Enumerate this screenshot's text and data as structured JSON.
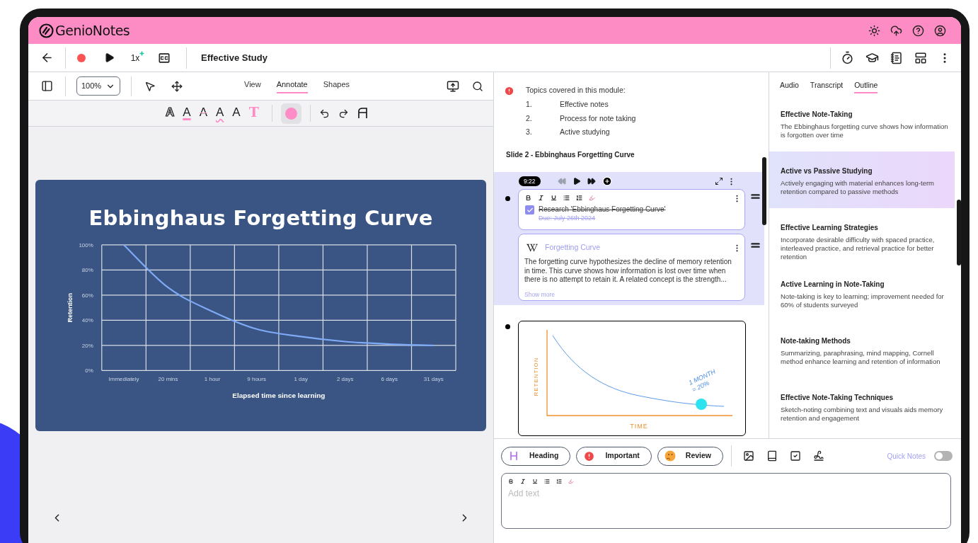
{
  "app": {
    "name": "GenioNotes"
  },
  "toolbar": {
    "speed": "1x",
    "title": "Effective Study"
  },
  "canvas_toolbar": {
    "zoom": "100%",
    "tabs": [
      {
        "label": "View",
        "selected": false
      },
      {
        "label": "Annotate",
        "selected": true
      },
      {
        "label": "Shapes",
        "selected": false
      }
    ]
  },
  "text_tools": [
    {
      "kind": "outline",
      "label": "A"
    },
    {
      "kind": "underline",
      "label": "A"
    },
    {
      "kind": "strike",
      "label": "A"
    },
    {
      "kind": "wavy",
      "label": "A"
    },
    {
      "kind": "plain",
      "label": "A"
    },
    {
      "kind": "type",
      "label": "T"
    }
  ],
  "slide": {
    "title": "Ebbinghaus Forgetting Curve",
    "chart_data": {
      "type": "line",
      "xlabel": "Elapsed time since learning",
      "ylabel": "Retention",
      "categories": [
        "Immediately",
        "20 mins",
        "1 hour",
        "9 hours",
        "1 day",
        "2 days",
        "6 days",
        "31 days"
      ],
      "series": [
        {
          "color": "#7eaaf6",
          "values": [
            100,
            66,
            47,
            33,
            27,
            23,
            21,
            20
          ]
        }
      ],
      "grid": true,
      "ylim": [
        0,
        100
      ],
      "yticks": [
        {
          "value": 0,
          "label": "0%"
        },
        {
          "value": 20,
          "label": "20%"
        },
        {
          "value": 40,
          "label": "40%"
        },
        {
          "value": 60,
          "label": "60%"
        },
        {
          "value": 80,
          "label": "80%"
        },
        {
          "value": 100,
          "label": "100%"
        }
      ]
    }
  },
  "notes": {
    "important": {
      "title": "Topics covered in this module:",
      "items": [
        {
          "number": "1.",
          "text": "Effective notes"
        },
        {
          "number": "2.",
          "text": "Process for note taking"
        },
        {
          "number": "3.",
          "text": "Active studying"
        }
      ]
    },
    "slide_heading": "Slide 2 - Ebbinghaus Forgetting Curve",
    "clip": {
      "time": "9:22",
      "rewind_disabled": true
    },
    "task": {
      "text": "Research 'Ebbinghaus Forgetting Curve'",
      "due": "Due: July 26th 2024",
      "checked": true
    },
    "wiki": {
      "title": "Forgetting Curve",
      "text": "The forgetting curve hypothesizes the decline of memory retention in time. This curve shows how information is lost over time when there is no attempt to retain it. A related concept is the strength...",
      "more": "Show more"
    },
    "sketch": {
      "ylabel": "RETENTION",
      "xlabel": "TIME",
      "note": [
        "1 MONTH",
        "= 20%"
      ]
    }
  },
  "outline": {
    "tabs": [
      {
        "label": "Audio",
        "selected": false
      },
      {
        "label": "Transcript",
        "selected": false
      },
      {
        "label": "Outline",
        "selected": true
      }
    ],
    "items": [
      {
        "title": "Effective Note-Taking",
        "summary": "The Ebbinghaus forgetting curve shows how information is forgotten over time",
        "selected": false
      },
      {
        "title": "Active vs Passive Studying",
        "summary": "Actively engaging with material enhances long-term retention compared to passive methods",
        "selected": true
      },
      {
        "title": "Effective Learning Strategies",
        "summary": "Incorporate desirable difficulty with spaced practice, interleaved practice, and retrieval practice for better retention",
        "selected": false
      },
      {
        "title": "Active Learning in Note-Taking",
        "summary": "Note-taking is key to learning; improvement needed for 60% of students surveyed",
        "selected": false
      },
      {
        "title": "Note-taking Methods",
        "summary": "Summarizing, paraphrasing, mind mapping, Cornell method enhance learning and retention of information",
        "selected": false
      },
      {
        "title": "Effective Note-Taking Techniques",
        "summary": "Sketch-noting combining text and visuals aids memory retention and engagement",
        "selected": false
      }
    ]
  },
  "composer": {
    "chips": [
      {
        "kind": "heading",
        "label": "Heading"
      },
      {
        "kind": "important",
        "label": "Important"
      },
      {
        "kind": "review",
        "label": "Review"
      }
    ],
    "quick_notes": {
      "label": "Quick Notes",
      "on": false
    },
    "placeholder": "Add text"
  }
}
